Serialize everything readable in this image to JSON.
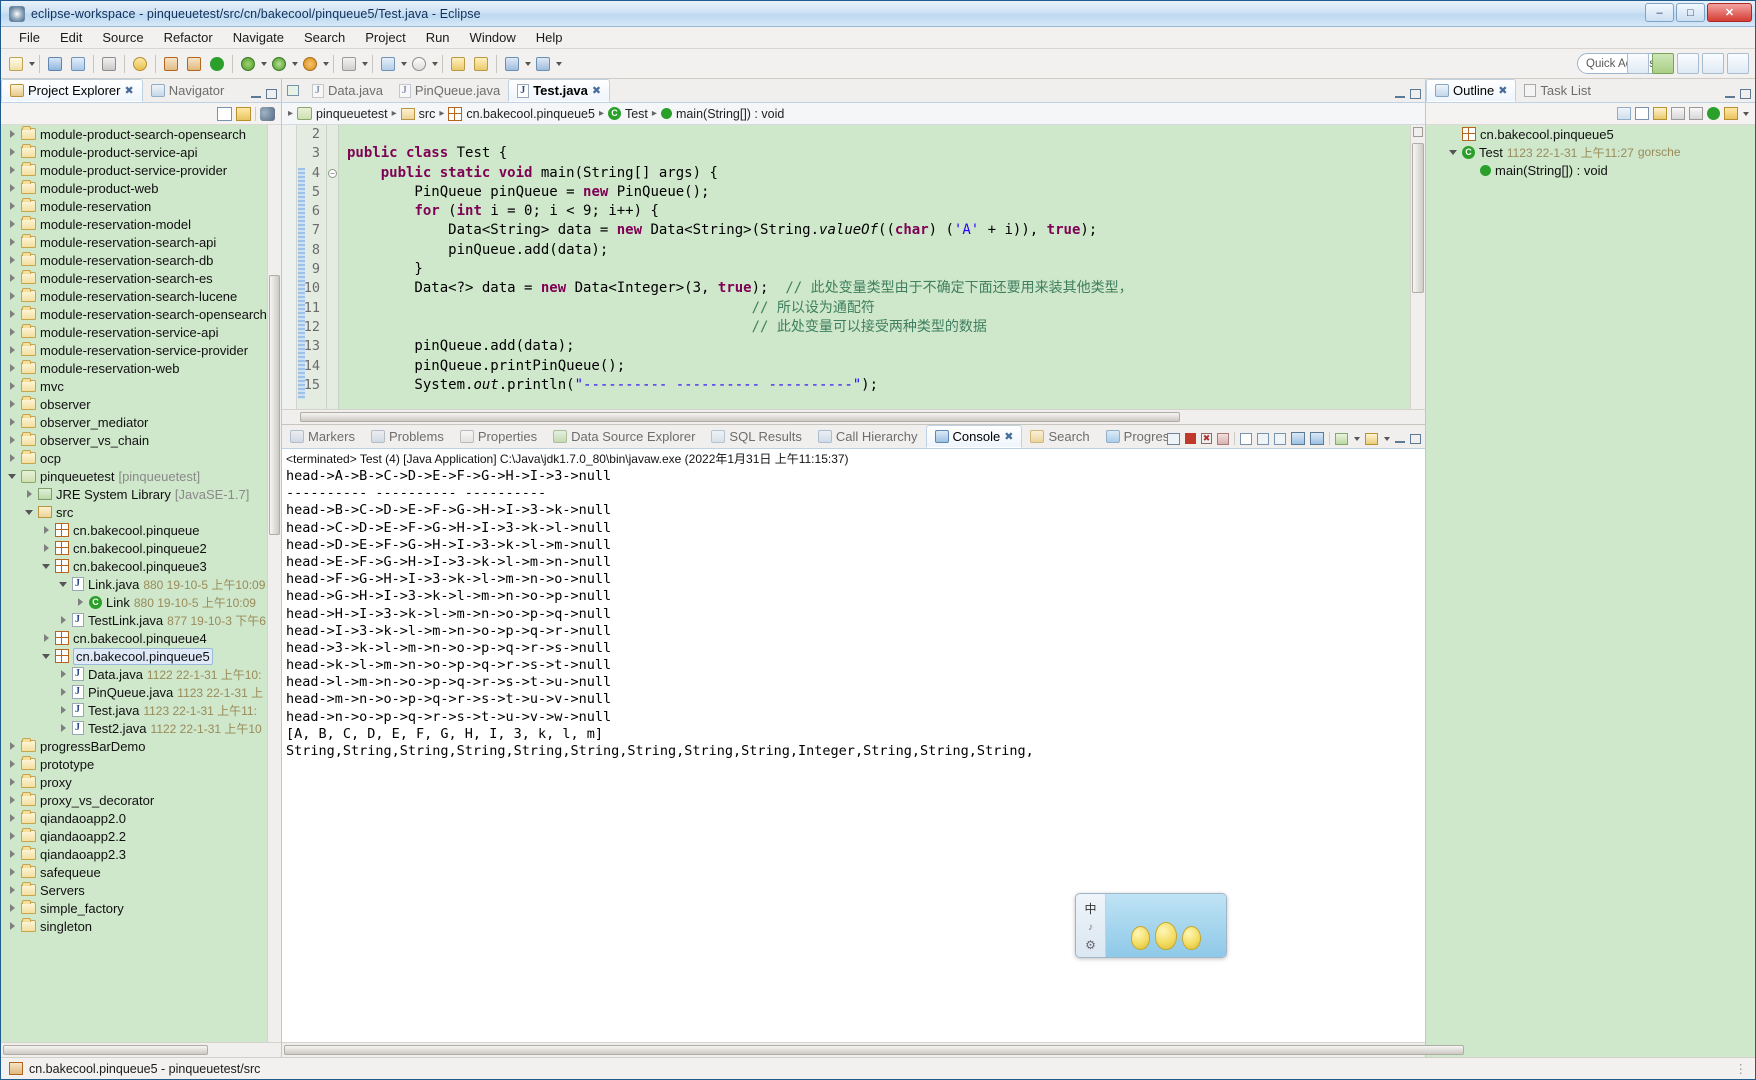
{
  "window": {
    "title": "eclipse-workspace - pinqueuetest/src/cn/bakecool/pinqueue5/Test.java - Eclipse",
    "minimize": "–",
    "maximize": "□",
    "close": "✕"
  },
  "menu": [
    "File",
    "Edit",
    "Source",
    "Refactor",
    "Navigate",
    "Search",
    "Project",
    "Run",
    "Window",
    "Help"
  ],
  "toolbar": {
    "quick_access": "Quick Access"
  },
  "explorer": {
    "tabs": [
      {
        "label": "Project Explorer",
        "active": true,
        "icon": "project-explorer-icon"
      },
      {
        "label": "Navigator",
        "active": false,
        "icon": "navigator-icon"
      }
    ],
    "tree": [
      {
        "indent": 0,
        "tw": "closed",
        "icon": "folder",
        "label": "module-product-search-opensearch"
      },
      {
        "indent": 0,
        "tw": "closed",
        "icon": "folder",
        "label": "module-product-service-api"
      },
      {
        "indent": 0,
        "tw": "closed",
        "icon": "folder",
        "label": "module-product-service-provider"
      },
      {
        "indent": 0,
        "tw": "closed",
        "icon": "folder",
        "label": "module-product-web"
      },
      {
        "indent": 0,
        "tw": "closed",
        "icon": "folder",
        "label": "module-reservation"
      },
      {
        "indent": 0,
        "tw": "closed",
        "icon": "folder",
        "label": "module-reservation-model"
      },
      {
        "indent": 0,
        "tw": "closed",
        "icon": "folder",
        "label": "module-reservation-search-api"
      },
      {
        "indent": 0,
        "tw": "closed",
        "icon": "folder",
        "label": "module-reservation-search-db"
      },
      {
        "indent": 0,
        "tw": "closed",
        "icon": "folder",
        "label": "module-reservation-search-es"
      },
      {
        "indent": 0,
        "tw": "closed",
        "icon": "folder",
        "label": "module-reservation-search-lucene"
      },
      {
        "indent": 0,
        "tw": "closed",
        "icon": "folder",
        "label": "module-reservation-search-opensearch"
      },
      {
        "indent": 0,
        "tw": "closed",
        "icon": "folder",
        "label": "module-reservation-service-api"
      },
      {
        "indent": 0,
        "tw": "closed",
        "icon": "folder",
        "label": "module-reservation-service-provider"
      },
      {
        "indent": 0,
        "tw": "closed",
        "icon": "folder",
        "label": "module-reservation-web"
      },
      {
        "indent": 0,
        "tw": "closed",
        "icon": "folder",
        "label": "mvc"
      },
      {
        "indent": 0,
        "tw": "closed",
        "icon": "folder",
        "label": "observer"
      },
      {
        "indent": 0,
        "tw": "closed",
        "icon": "folder",
        "label": "observer_mediator"
      },
      {
        "indent": 0,
        "tw": "closed",
        "icon": "folder",
        "label": "observer_vs_chain"
      },
      {
        "indent": 0,
        "tw": "closed",
        "icon": "folder",
        "label": "ocp"
      },
      {
        "indent": 0,
        "tw": "open",
        "icon": "project",
        "label": "pinqueuetest",
        "meta": "[pinqueuetest]"
      },
      {
        "indent": 1,
        "tw": "closed",
        "icon": "jre",
        "label": "JRE System Library",
        "meta": "[JavaSE-1.7]"
      },
      {
        "indent": 1,
        "tw": "open",
        "icon": "srcfolder",
        "label": "src"
      },
      {
        "indent": 2,
        "tw": "closed",
        "icon": "package",
        "label": "cn.bakecool.pinqueue"
      },
      {
        "indent": 2,
        "tw": "closed",
        "icon": "package",
        "label": "cn.bakecool.pinqueue2"
      },
      {
        "indent": 2,
        "tw": "open",
        "icon": "package",
        "label": "cn.bakecool.pinqueue3"
      },
      {
        "indent": 3,
        "tw": "open",
        "icon": "javafile",
        "label": "Link.java",
        "meta": "880  19-10-5 上午10:09"
      },
      {
        "indent": 4,
        "tw": "closed",
        "icon": "class",
        "label": "Link",
        "meta": "880  19-10-5 上午10:09"
      },
      {
        "indent": 3,
        "tw": "closed",
        "icon": "javafile",
        "label": "TestLink.java",
        "meta": "877  19-10-3 下午6"
      },
      {
        "indent": 2,
        "tw": "closed",
        "icon": "package",
        "label": "cn.bakecool.pinqueue4"
      },
      {
        "indent": 2,
        "tw": "open",
        "icon": "package",
        "label": "cn.bakecool.pinqueue5",
        "selected": true
      },
      {
        "indent": 3,
        "tw": "closed",
        "icon": "javafile",
        "label": "Data.java",
        "meta": "1122  22-1-31 上午10:"
      },
      {
        "indent": 3,
        "tw": "closed",
        "icon": "javafile",
        "label": "PinQueue.java",
        "meta": "1123  22-1-31 上"
      },
      {
        "indent": 3,
        "tw": "closed",
        "icon": "javafile",
        "label": "Test.java",
        "meta": "1123  22-1-31 上午11:"
      },
      {
        "indent": 3,
        "tw": "closed",
        "icon": "javafile",
        "label": "Test2.java",
        "meta": "1122  22-1-31 上午10"
      },
      {
        "indent": 0,
        "tw": "closed",
        "icon": "folder",
        "label": "progressBarDemo"
      },
      {
        "indent": 0,
        "tw": "closed",
        "icon": "folder",
        "label": "prototype"
      },
      {
        "indent": 0,
        "tw": "closed",
        "icon": "folder",
        "label": "proxy"
      },
      {
        "indent": 0,
        "tw": "closed",
        "icon": "folder",
        "label": "proxy_vs_decorator"
      },
      {
        "indent": 0,
        "tw": "closed",
        "icon": "folder",
        "label": "qiandaoapp2.0"
      },
      {
        "indent": 0,
        "tw": "closed",
        "icon": "folder",
        "label": "qiandaoapp2.2"
      },
      {
        "indent": 0,
        "tw": "closed",
        "icon": "folder",
        "label": "qiandaoapp2.3"
      },
      {
        "indent": 0,
        "tw": "closed",
        "icon": "folder",
        "label": "safequeue"
      },
      {
        "indent": 0,
        "tw": "closed",
        "icon": "folder",
        "label": "Servers"
      },
      {
        "indent": 0,
        "tw": "closed",
        "icon": "folder",
        "label": "simple_factory"
      },
      {
        "indent": 0,
        "tw": "closed",
        "icon": "folder",
        "label": "singleton"
      }
    ]
  },
  "editor": {
    "tabs": [
      {
        "label": "Data.java",
        "active": false
      },
      {
        "label": "PinQueue.java",
        "active": false
      },
      {
        "label": "Test.java",
        "active": true
      }
    ],
    "breadcrumb": [
      "pinqueuetest",
      "src",
      "cn.bakecool.pinqueue5",
      "Test",
      "main(String[]) : void"
    ],
    "first_line": 2,
    "lines": [
      {
        "n": 2,
        "html": ""
      },
      {
        "n": 3,
        "html": "<span class=\"kw\">public class</span> Test {"
      },
      {
        "n": 4,
        "html": "    <span class=\"kw\">public static void</span> main(String[] args) {",
        "fold": true
      },
      {
        "n": 5,
        "html": "        PinQueue pinQueue = <span class=\"kw\">new</span> PinQueue();"
      },
      {
        "n": 6,
        "html": "        <span class=\"kw\">for</span> (<span class=\"kw\">int</span> i = 0; i &lt; 9; i++) {"
      },
      {
        "n": 7,
        "html": "            Data&lt;String&gt; data = <span class=\"kw\">new</span> Data&lt;String&gt;(String.<span class=\"stat\">valueOf</span>((<span class=\"kw\">char</span>) (<span class=\"str\">'A'</span> + i)), <span class=\"kw\">true</span>);"
      },
      {
        "n": 8,
        "html": "            pinQueue.add(data);"
      },
      {
        "n": 9,
        "html": "        }"
      },
      {
        "n": 10,
        "html": "        Data&lt;?&gt; data = <span class=\"kw\">new</span> Data&lt;Integer&gt;(3, <span class=\"kw\">true</span>);  <span class=\"cmt\">// 此处变量类型由于不确定下面还要用来装其他类型，</span>"
      },
      {
        "n": 11,
        "html": "                                                <span class=\"cmt\">// 所以设为通配符</span>"
      },
      {
        "n": 12,
        "html": "                                                <span class=\"cmt\">// 此处变量可以接受两种类型的数据</span>"
      },
      {
        "n": 13,
        "html": "        pinQueue.add(data);"
      },
      {
        "n": 14,
        "html": "        pinQueue.printPinQueue();"
      },
      {
        "n": 15,
        "html": "        System.<span class=\"stat\">out</span>.println(<span class=\"str\">\"---------- ---------- ----------\"</span>);"
      }
    ]
  },
  "console": {
    "tabs": [
      {
        "label": "Markers",
        "active": false,
        "icon": "markers-icon"
      },
      {
        "label": "Problems",
        "active": false,
        "icon": "problems-icon"
      },
      {
        "label": "Properties",
        "active": false,
        "icon": "properties-icon"
      },
      {
        "label": "Data Source Explorer",
        "active": false,
        "icon": "data-source-icon"
      },
      {
        "label": "SQL Results",
        "active": false,
        "icon": "sql-results-icon"
      },
      {
        "label": "Call Hierarchy",
        "active": false,
        "icon": "call-hierarchy-icon"
      },
      {
        "label": "Console",
        "active": true,
        "icon": "console-icon"
      },
      {
        "label": "Search",
        "active": false,
        "icon": "search-icon"
      },
      {
        "label": "Progress",
        "active": false,
        "icon": "progress-icon"
      }
    ],
    "launch_info": "<terminated> Test (4) [Java Application] C:\\Java\\jdk1.7.0_80\\bin\\javaw.exe (2022年1月31日 上午11:15:37)",
    "output": [
      "head->A->B->C->D->E->F->G->H->I->3->null",
      "---------- ---------- ----------",
      "head->B->C->D->E->F->G->H->I->3->k->null",
      "head->C->D->E->F->G->H->I->3->k->l->null",
      "head->D->E->F->G->H->I->3->k->l->m->null",
      "head->E->F->G->H->I->3->k->l->m->n->null",
      "head->F->G->H->I->3->k->l->m->n->o->null",
      "head->G->H->I->3->k->l->m->n->o->p->null",
      "head->H->I->3->k->l->m->n->o->p->q->null",
      "head->I->3->k->l->m->n->o->p->q->r->null",
      "head->3->k->l->m->n->o->p->q->r->s->null",
      "head->k->l->m->n->o->p->q->r->s->t->null",
      "head->l->m->n->o->p->q->r->s->t->u->null",
      "head->m->n->o->p->q->r->s->t->u->v->null",
      "head->n->o->p->q->r->s->t->u->v->w->null",
      "[A, B, C, D, E, F, G, H, I, 3, k, l, m]",
      "String,String,String,String,String,String,String,String,String,Integer,String,String,String,"
    ]
  },
  "outline": {
    "tabs": [
      {
        "label": "Outline",
        "active": true,
        "icon": "outline-icon"
      },
      {
        "label": "Task List",
        "active": false,
        "icon": "task-list-icon"
      }
    ],
    "items": [
      {
        "indent": 0,
        "tw": "none",
        "icon": "package",
        "label": "cn.bakecool.pinqueue5",
        "meta": ""
      },
      {
        "indent": 0,
        "tw": "open",
        "icon": "class",
        "label": "Test",
        "meta": "1123  22-1-31 上午11:27",
        "meta2": "gorsche"
      },
      {
        "indent": 1,
        "tw": "none",
        "icon": "method",
        "label": "main(String[]) : void",
        "meta": ""
      }
    ]
  },
  "status": {
    "text": "cn.bakecool.pinqueue5 - pinqueuetest/src"
  },
  "ime": {
    "mode": "中",
    "sub": "♪",
    "gear": "⚙"
  }
}
